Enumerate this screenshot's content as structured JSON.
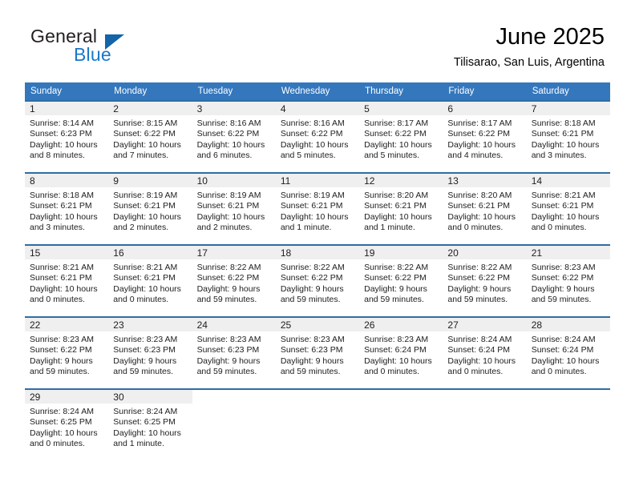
{
  "brand": {
    "word_one": "General",
    "word_two": "Blue",
    "triangle_icon": "triangle-icon"
  },
  "header": {
    "month_title": "June 2025",
    "location": "Tilisarao, San Luis, Argentina"
  },
  "calendar": {
    "weekday_headers": [
      "Sunday",
      "Monday",
      "Tuesday",
      "Wednesday",
      "Thursday",
      "Friday",
      "Saturday"
    ],
    "accent_color": "#3477bd",
    "row_border_color": "#2e6da4",
    "daynum_band_color": "#efefef",
    "weeks": [
      [
        {
          "day": "1",
          "sunrise": "Sunrise: 8:14 AM",
          "sunset": "Sunset: 6:23 PM",
          "daylight": "Daylight: 10 hours and 8 minutes."
        },
        {
          "day": "2",
          "sunrise": "Sunrise: 8:15 AM",
          "sunset": "Sunset: 6:22 PM",
          "daylight": "Daylight: 10 hours and 7 minutes."
        },
        {
          "day": "3",
          "sunrise": "Sunrise: 8:16 AM",
          "sunset": "Sunset: 6:22 PM",
          "daylight": "Daylight: 10 hours and 6 minutes."
        },
        {
          "day": "4",
          "sunrise": "Sunrise: 8:16 AM",
          "sunset": "Sunset: 6:22 PM",
          "daylight": "Daylight: 10 hours and 5 minutes."
        },
        {
          "day": "5",
          "sunrise": "Sunrise: 8:17 AM",
          "sunset": "Sunset: 6:22 PM",
          "daylight": "Daylight: 10 hours and 5 minutes."
        },
        {
          "day": "6",
          "sunrise": "Sunrise: 8:17 AM",
          "sunset": "Sunset: 6:22 PM",
          "daylight": "Daylight: 10 hours and 4 minutes."
        },
        {
          "day": "7",
          "sunrise": "Sunrise: 8:18 AM",
          "sunset": "Sunset: 6:21 PM",
          "daylight": "Daylight: 10 hours and 3 minutes."
        }
      ],
      [
        {
          "day": "8",
          "sunrise": "Sunrise: 8:18 AM",
          "sunset": "Sunset: 6:21 PM",
          "daylight": "Daylight: 10 hours and 3 minutes."
        },
        {
          "day": "9",
          "sunrise": "Sunrise: 8:19 AM",
          "sunset": "Sunset: 6:21 PM",
          "daylight": "Daylight: 10 hours and 2 minutes."
        },
        {
          "day": "10",
          "sunrise": "Sunrise: 8:19 AM",
          "sunset": "Sunset: 6:21 PM",
          "daylight": "Daylight: 10 hours and 2 minutes."
        },
        {
          "day": "11",
          "sunrise": "Sunrise: 8:19 AM",
          "sunset": "Sunset: 6:21 PM",
          "daylight": "Daylight: 10 hours and 1 minute."
        },
        {
          "day": "12",
          "sunrise": "Sunrise: 8:20 AM",
          "sunset": "Sunset: 6:21 PM",
          "daylight": "Daylight: 10 hours and 1 minute."
        },
        {
          "day": "13",
          "sunrise": "Sunrise: 8:20 AM",
          "sunset": "Sunset: 6:21 PM",
          "daylight": "Daylight: 10 hours and 0 minutes."
        },
        {
          "day": "14",
          "sunrise": "Sunrise: 8:21 AM",
          "sunset": "Sunset: 6:21 PM",
          "daylight": "Daylight: 10 hours and 0 minutes."
        }
      ],
      [
        {
          "day": "15",
          "sunrise": "Sunrise: 8:21 AM",
          "sunset": "Sunset: 6:21 PM",
          "daylight": "Daylight: 10 hours and 0 minutes."
        },
        {
          "day": "16",
          "sunrise": "Sunrise: 8:21 AM",
          "sunset": "Sunset: 6:21 PM",
          "daylight": "Daylight: 10 hours and 0 minutes."
        },
        {
          "day": "17",
          "sunrise": "Sunrise: 8:22 AM",
          "sunset": "Sunset: 6:22 PM",
          "daylight": "Daylight: 9 hours and 59 minutes."
        },
        {
          "day": "18",
          "sunrise": "Sunrise: 8:22 AM",
          "sunset": "Sunset: 6:22 PM",
          "daylight": "Daylight: 9 hours and 59 minutes."
        },
        {
          "day": "19",
          "sunrise": "Sunrise: 8:22 AM",
          "sunset": "Sunset: 6:22 PM",
          "daylight": "Daylight: 9 hours and 59 minutes."
        },
        {
          "day": "20",
          "sunrise": "Sunrise: 8:22 AM",
          "sunset": "Sunset: 6:22 PM",
          "daylight": "Daylight: 9 hours and 59 minutes."
        },
        {
          "day": "21",
          "sunrise": "Sunrise: 8:23 AM",
          "sunset": "Sunset: 6:22 PM",
          "daylight": "Daylight: 9 hours and 59 minutes."
        }
      ],
      [
        {
          "day": "22",
          "sunrise": "Sunrise: 8:23 AM",
          "sunset": "Sunset: 6:22 PM",
          "daylight": "Daylight: 9 hours and 59 minutes."
        },
        {
          "day": "23",
          "sunrise": "Sunrise: 8:23 AM",
          "sunset": "Sunset: 6:23 PM",
          "daylight": "Daylight: 9 hours and 59 minutes."
        },
        {
          "day": "24",
          "sunrise": "Sunrise: 8:23 AM",
          "sunset": "Sunset: 6:23 PM",
          "daylight": "Daylight: 9 hours and 59 minutes."
        },
        {
          "day": "25",
          "sunrise": "Sunrise: 8:23 AM",
          "sunset": "Sunset: 6:23 PM",
          "daylight": "Daylight: 9 hours and 59 minutes."
        },
        {
          "day": "26",
          "sunrise": "Sunrise: 8:23 AM",
          "sunset": "Sunset: 6:24 PM",
          "daylight": "Daylight: 10 hours and 0 minutes."
        },
        {
          "day": "27",
          "sunrise": "Sunrise: 8:24 AM",
          "sunset": "Sunset: 6:24 PM",
          "daylight": "Daylight: 10 hours and 0 minutes."
        },
        {
          "day": "28",
          "sunrise": "Sunrise: 8:24 AM",
          "sunset": "Sunset: 6:24 PM",
          "daylight": "Daylight: 10 hours and 0 minutes."
        }
      ],
      [
        {
          "day": "29",
          "sunrise": "Sunrise: 8:24 AM",
          "sunset": "Sunset: 6:25 PM",
          "daylight": "Daylight: 10 hours and 0 minutes."
        },
        {
          "day": "30",
          "sunrise": "Sunrise: 8:24 AM",
          "sunset": "Sunset: 6:25 PM",
          "daylight": "Daylight: 10 hours and 1 minute."
        },
        null,
        null,
        null,
        null,
        null
      ]
    ]
  }
}
